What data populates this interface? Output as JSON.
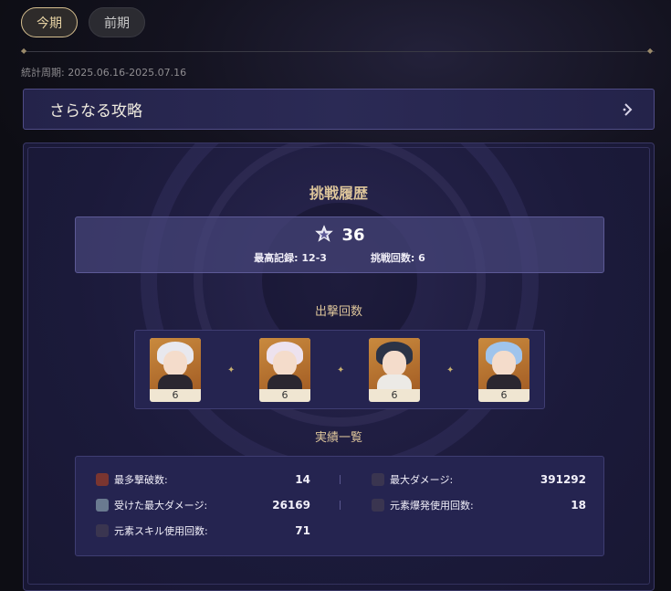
{
  "tabs": [
    {
      "label": "今期",
      "active": true
    },
    {
      "label": "前期",
      "active": false
    }
  ],
  "period": "統計周期: 2025.06.16-2025.07.16",
  "more_link": {
    "label": "さらなる攻略",
    "icon": "chevron-right-icon"
  },
  "history": {
    "title": "挑戦履歴",
    "star_icon": "star-icon",
    "stars": "36",
    "best_record": "最高記録: 12-3",
    "attempts": "挑戦回数: 6"
  },
  "team": {
    "title": "出撃回数",
    "characters": [
      {
        "count": "6",
        "hair_color": "#e8e8ee"
      },
      {
        "count": "6",
        "hair_color": "#ede2ee"
      },
      {
        "count": "6",
        "hair_color": "#2b3346"
      },
      {
        "count": "6",
        "hair_color": "#9fc4ec"
      }
    ]
  },
  "achievements": {
    "title": "実績一覧",
    "items": [
      {
        "label": "最多撃破数:",
        "value": "14"
      },
      {
        "label": "最大ダメージ:",
        "value": "391292"
      },
      {
        "label": "受けた最大ダメージ:",
        "value": "26169"
      },
      {
        "label": "元素爆発使用回数:",
        "value": "18"
      },
      {
        "label": "元素スキル使用回数:",
        "value": "71"
      }
    ]
  },
  "colors": {
    "accent_gold": "#dcc49a",
    "panel": "#252450"
  }
}
